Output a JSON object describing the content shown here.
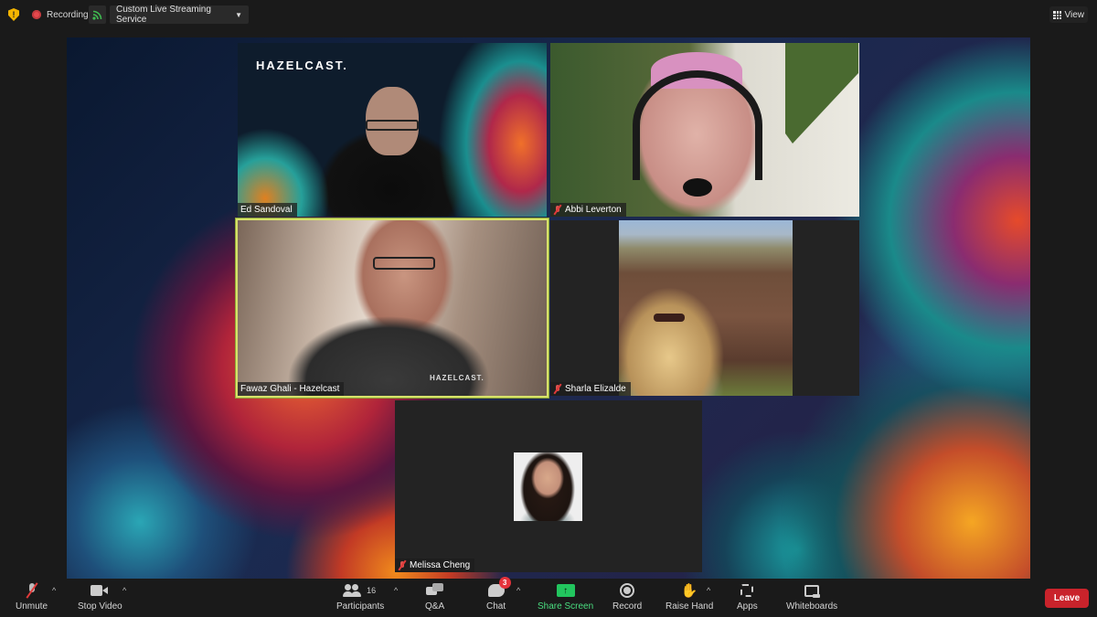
{
  "topbar": {
    "security_icon": "shield-icon",
    "recording_label": "Recording",
    "stream_icon": "rss-stream-icon",
    "stream_service": "Custom Live Streaming Service",
    "view_label": "View"
  },
  "participants": [
    {
      "name": "Ed Sandoval",
      "muted": false,
      "active_speaker": false,
      "video_logo": "HAZELCAST."
    },
    {
      "name": "Abbi Leverton",
      "muted": true,
      "active_speaker": false
    },
    {
      "name": "Fawaz Ghali - Hazelcast",
      "muted": false,
      "active_speaker": true,
      "shirt_logo": "HAZELCAST."
    },
    {
      "name": "Sharla Elizalde",
      "muted": true,
      "active_speaker": false
    },
    {
      "name": "Melissa Cheng",
      "muted": true,
      "active_speaker": false,
      "video_off": true
    }
  ],
  "toolbar": {
    "unmute": "Unmute",
    "stop_video": "Stop Video",
    "participants": "Participants",
    "participants_count": "16",
    "qa": "Q&A",
    "chat": "Chat",
    "chat_badge": "3",
    "share_screen": "Share Screen",
    "share_icon_glyph": "↑",
    "record": "Record",
    "raise_hand": "Raise Hand",
    "hand_glyph": "✋",
    "apps": "Apps",
    "whiteboards": "Whiteboards",
    "leave": "Leave",
    "caret_glyph": "^"
  },
  "colors": {
    "leave": "#c9232b",
    "share": "#22c55e",
    "share_label": "#4ade80",
    "active_speaker_border": "#d7e26a",
    "badge": "#e5323b",
    "muted": "#e03a3a"
  }
}
